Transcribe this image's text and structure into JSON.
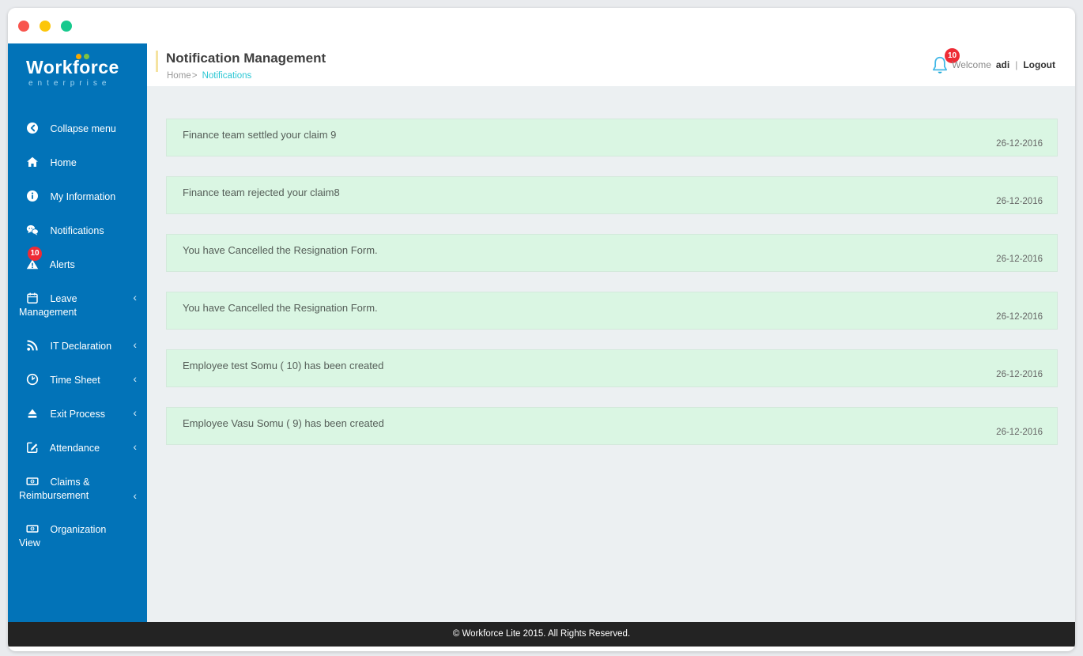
{
  "brand": {
    "name": "Workforce",
    "tagline": "enterprise"
  },
  "sidebar": {
    "items": [
      {
        "label": "Collapse menu",
        "icon": "collapse-icon"
      },
      {
        "label": "Home",
        "icon": "home-icon"
      },
      {
        "label": "My Information",
        "icon": "info-icon"
      },
      {
        "label": "Notifications",
        "icon": "chat-bubbles-icon"
      },
      {
        "label": "Alerts",
        "icon": "warning-icon",
        "badge": "10"
      },
      {
        "label": "Leave Management",
        "icon": "calendar-icon",
        "expandable": true
      },
      {
        "label": "IT Declaration",
        "icon": "rss-icon",
        "expandable": true
      },
      {
        "label": "Time Sheet",
        "icon": "clock-icon",
        "expandable": true
      },
      {
        "label": "Exit Process",
        "icon": "eject-icon",
        "expandable": true
      },
      {
        "label": "Attendance",
        "icon": "edit-icon",
        "expandable": true
      },
      {
        "label": "Claims & Reimbursement",
        "icon": "money-icon",
        "expandable": true
      },
      {
        "label": "Organization View",
        "icon": "money-icon"
      }
    ]
  },
  "header": {
    "title": "Notification Management",
    "breadcrumb": {
      "home": "Home",
      "separator": ">",
      "current": "Notifications"
    },
    "bell_badge": "10",
    "welcome_label": "Welcome",
    "username": "adi",
    "divider": "|",
    "logout_label": "Logout"
  },
  "notifications": {
    "items": [
      {
        "message": "Finance team settled your claim 9",
        "date": "26-12-2016"
      },
      {
        "message": "Finance team rejected your claim8",
        "date": "26-12-2016"
      },
      {
        "message": "You have Cancelled the Resignation Form.",
        "date": "26-12-2016"
      },
      {
        "message": "You have Cancelled the Resignation Form.",
        "date": "26-12-2016"
      },
      {
        "message": "Employee test Somu ( 10) has been created",
        "date": "26-12-2016"
      },
      {
        "message": "Employee Vasu Somu ( 9) has been created",
        "date": "26-12-2016"
      }
    ]
  },
  "footer": {
    "copyright": "© Workforce Lite 2015. All Rights Reserved."
  },
  "glyphs": {
    "chevron": "‹"
  },
  "colors": {
    "sidebar_blue": "#0273b8",
    "accent_cyan": "#2bc7d4",
    "card_green": "#daf6e3",
    "badge_red": "#ee2b35",
    "bell_blue": "#41b7e6",
    "footer_dark": "#232323",
    "traffic_close": "#f8544d",
    "traffic_minimize": "#fcc60a",
    "traffic_maximize": "#16c98d",
    "logo_dot_orange": "#f7a800",
    "logo_dot_green": "#7fc241"
  }
}
